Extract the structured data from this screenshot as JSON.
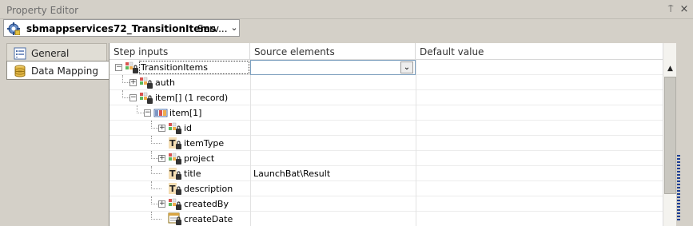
{
  "window": {
    "title": "Property Editor",
    "pin_glyph": "⍑",
    "close_glyph": "×"
  },
  "object_selector": {
    "name": "sbmappservices72_TransitionItems",
    "type": "Serv...",
    "arrow_glyph": "⌄"
  },
  "tabs": [
    {
      "label": "General",
      "icon": "general-icon"
    },
    {
      "label": "Data Mapping",
      "icon": "database-icon"
    }
  ],
  "grid": {
    "columns": [
      "Step inputs",
      "Source elements",
      "Default value"
    ],
    "rows": [
      {
        "label": "TransitionItems",
        "source": "",
        "default": "",
        "icon": "record-icon",
        "expander": "−",
        "selected": true
      },
      {
        "label": "auth",
        "source": "",
        "default": "",
        "icon": "record-icon",
        "expander": "+"
      },
      {
        "label": "item[] (1 record)",
        "source": "",
        "default": "",
        "icon": "record-icon",
        "expander": "−"
      },
      {
        "label": "item[1]",
        "source": "",
        "default": "",
        "icon": "array-item-icon",
        "expander": "−"
      },
      {
        "label": "id",
        "source": "",
        "default": "",
        "icon": "record-icon",
        "expander": "+"
      },
      {
        "label": "itemType",
        "source": "",
        "default": "",
        "icon": "text-icon",
        "expander": ""
      },
      {
        "label": "project",
        "source": "",
        "default": "",
        "icon": "record-icon",
        "expander": "+"
      },
      {
        "label": "title",
        "source": "LaunchBat\\Result",
        "default": "",
        "icon": "text-icon",
        "expander": ""
      },
      {
        "label": "description",
        "source": "",
        "default": "",
        "icon": "text-icon",
        "expander": ""
      },
      {
        "label": "createdBy",
        "source": "",
        "default": "",
        "icon": "record-icon",
        "expander": "+"
      },
      {
        "label": "createDate",
        "source": "",
        "default": "",
        "icon": "date-icon",
        "expander": ""
      }
    ]
  },
  "scrollbar": {
    "up_glyph": "▲"
  }
}
